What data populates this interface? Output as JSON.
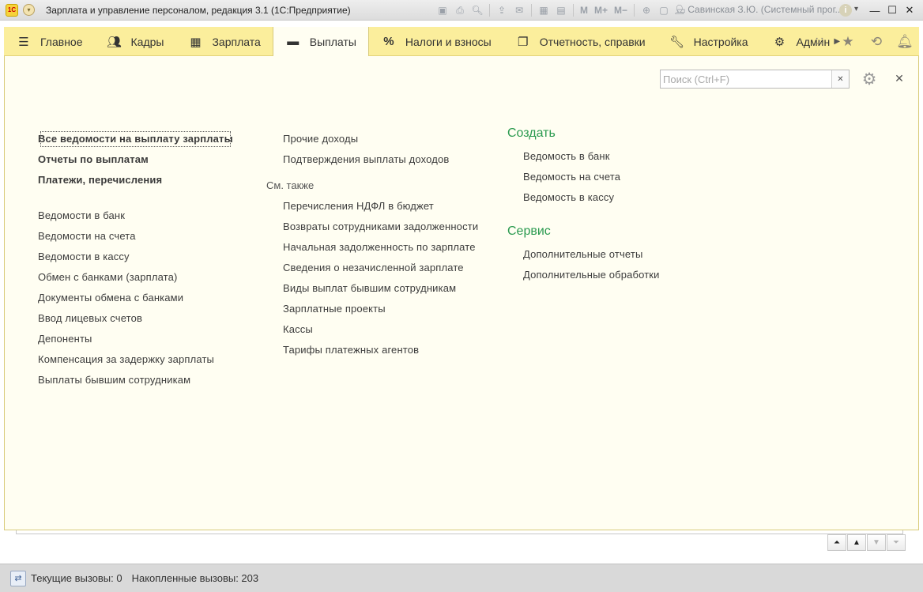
{
  "window": {
    "logo": "1С",
    "title": "Зарплата и управление персоналом, редакция 3.1  (1С:Предприятие)",
    "user": "Савинская З.Ю. (Системный прог...",
    "toolbar_text_buttons": [
      "M",
      "M+",
      "M−"
    ]
  },
  "sections": [
    {
      "label": "Главное",
      "icon": "menu-icon"
    },
    {
      "label": "Кадры",
      "icon": "people-icon"
    },
    {
      "label": "Зарплата",
      "icon": "calculator-icon"
    },
    {
      "label": "Выплаты",
      "icon": "wallet-icon",
      "active": true
    },
    {
      "label": "Налоги и взносы",
      "icon": "percent-icon"
    },
    {
      "label": "Отчетность, справки",
      "icon": "reports-icon"
    },
    {
      "label": "Настройка",
      "icon": "wrench-icon"
    },
    {
      "label": "Админ",
      "icon": "gear-icon"
    }
  ],
  "search": {
    "placeholder": "Поиск (Ctrl+F)",
    "value": ""
  },
  "col1": {
    "bold_items": [
      "Все ведомости на выплату зарплаты",
      "Отчеты по выплатам",
      "Платежи, перечисления"
    ],
    "items": [
      "Ведомости в банк",
      "Ведомости на счета",
      "Ведомости в кассу",
      "Обмен с банками (зарплата)",
      "Документы обмена с банками",
      "Ввод лицевых счетов",
      "Депоненты",
      "Компенсация за задержку зарплаты",
      "Выплаты бывшим сотрудникам"
    ]
  },
  "col2": {
    "items": [
      "Прочие доходы",
      "Подтверждения выплаты доходов"
    ],
    "see_also_title": "См. также",
    "see_also": [
      "Перечисления НДФЛ в бюджет",
      "Возвраты сотрудниками задолженности",
      "Начальная задолженность по зарплате",
      "Сведения о незачисленной зарплате",
      "Виды выплат бывшим сотрудникам",
      "Зарплатные проекты",
      "Кассы",
      "Тарифы платежных агентов"
    ]
  },
  "col3": {
    "create_title": "Создать",
    "create": [
      "Ведомость в банк",
      "Ведомость на счета",
      "Ведомость в кассу"
    ],
    "service_title": "Сервис",
    "service": [
      "Дополнительные отчеты",
      "Дополнительные обработки"
    ]
  },
  "status": {
    "current_calls": "Текущие вызовы: 0",
    "accumulated_calls": "Накопленные вызовы: 203"
  },
  "colors": {
    "section_bg": "#fbee9c",
    "content_bg": "#fffef2",
    "group_title": "#2a9a4f"
  }
}
